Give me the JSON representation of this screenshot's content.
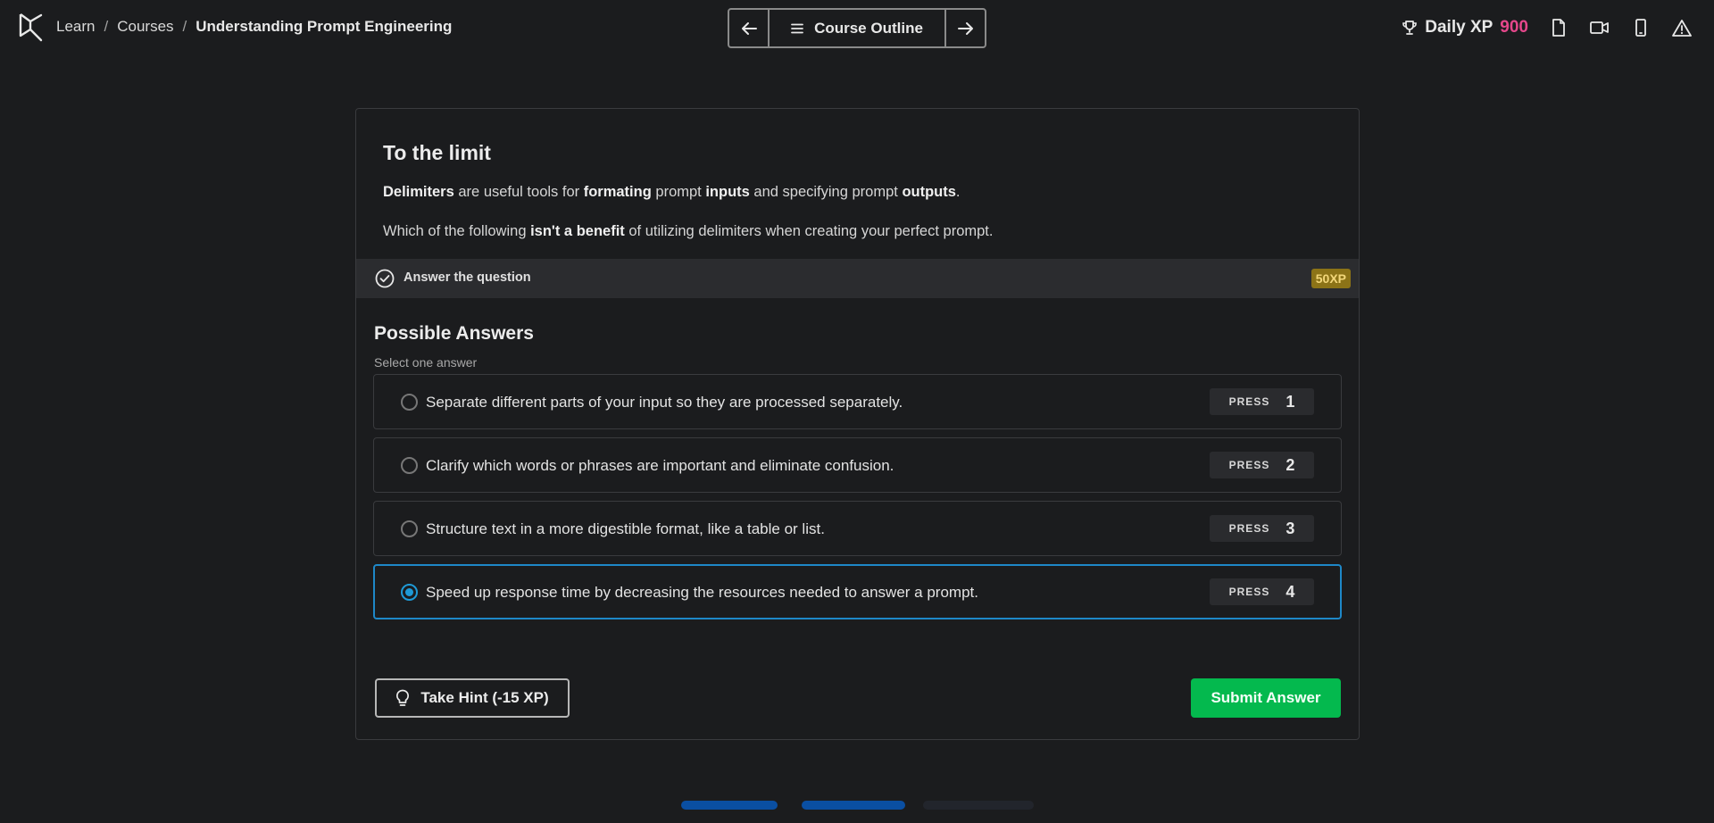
{
  "breadcrumb": {
    "learn": "Learn",
    "courses": "Courses",
    "current": "Understanding Prompt Engineering",
    "separator": "/"
  },
  "outline_nav": {
    "label": "Course Outline",
    "prev_icon": "arrow-left-icon",
    "next_icon": "arrow-right-icon"
  },
  "top_right": {
    "daily_xp_label": "Daily XP",
    "daily_xp_value": "900",
    "icons": [
      "trophy-icon",
      "document-icon",
      "video-icon",
      "mobile-icon",
      "warning-icon"
    ]
  },
  "exercise": {
    "title": "To the limit",
    "paragraph1": {
      "parts": [
        "Delimiters",
        " are useful tools for ",
        "formating",
        " prompt ",
        "inputs",
        " and specifying prompt ",
        "outputs",
        "."
      ]
    },
    "paragraph2": {
      "parts": [
        "Which of the following ",
        "isn't a benefit",
        " of utilizing delimiters when creating your perfect prompt."
      ]
    },
    "task_label": "Answer the question",
    "xp_badge": "50XP"
  },
  "answers": {
    "title": "Possible Answers",
    "subtitle": "Select one answer",
    "press_word": "PRESS",
    "options": [
      {
        "text": "Separate different parts of your input so they are processed separately.",
        "key": "1",
        "selected": false
      },
      {
        "text": "Clarify which words or phrases are important and eliminate confusion.",
        "key": "2",
        "selected": false
      },
      {
        "text": "Structure text in a more digestible format, like a table or list.",
        "key": "3",
        "selected": false
      },
      {
        "text": "Speed up response time by decreasing the resources needed to answer a prompt.",
        "key": "4",
        "selected": true
      }
    ]
  },
  "actions": {
    "hint_label": "Take Hint (-15 XP)",
    "submit_label": "Submit Answer"
  },
  "colors": {
    "background": "#1b1c1e",
    "xp_accent": "#e5478b",
    "submit": "#04b94e",
    "selected_border": "#1e88c8",
    "badge": "#8c7317",
    "progress_active": "#0a4fa2"
  },
  "progress": {
    "completed_segments": 2,
    "total_segments": 3
  }
}
